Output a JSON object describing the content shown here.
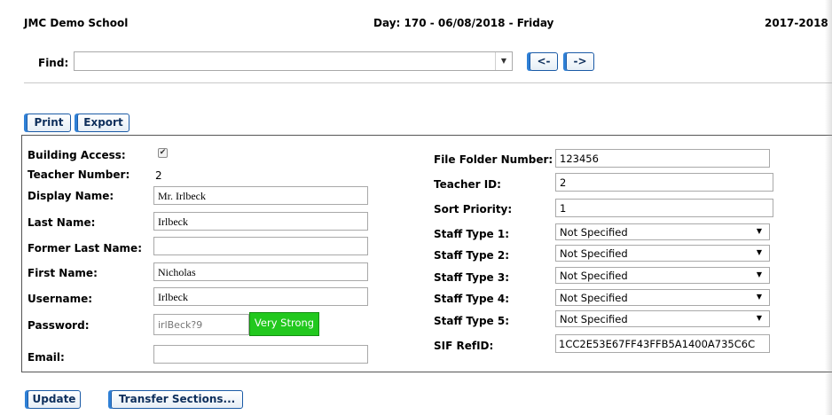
{
  "header": {
    "school": "JMC Demo School",
    "day": "Day: 170 - 06/08/2018 - Friday",
    "year": "2017-2018"
  },
  "find": {
    "label": "Find:",
    "value": "",
    "prev_label": "<-",
    "next_label": "->"
  },
  "toolbar": {
    "print_label": "Print",
    "export_label": "Export"
  },
  "left_fields": {
    "building_access_label": "Building Access:",
    "building_access_checked": true,
    "teacher_number_label": "Teacher Number:",
    "teacher_number_value": "2",
    "display_name_label": "Display Name:",
    "display_name_value": "Mr. Irlbeck",
    "last_name_label": "Last Name:",
    "last_name_value": "Irlbeck",
    "former_last_name_label": "Former Last Name:",
    "former_last_name_value": "",
    "first_name_label": "First Name:",
    "first_name_value": "Nicholas",
    "username_label": "Username:",
    "username_value": "Irlbeck",
    "password_label": "Password:",
    "password_value": "irlBeck?9",
    "password_strength": "Very Strong",
    "email_label": "Email:",
    "email_value": ""
  },
  "right_fields": {
    "file_folder_label": "File Folder Number:",
    "file_folder_value": "123456",
    "teacher_id_label": "Teacher ID:",
    "teacher_id_value": "2",
    "sort_priority_label": "Sort Priority:",
    "sort_priority_value": "1",
    "staff_types": [
      {
        "label": "Staff Type 1:",
        "value": "Not Specified"
      },
      {
        "label": "Staff Type 2:",
        "value": "Not Specified"
      },
      {
        "label": "Staff Type 3:",
        "value": "Not Specified"
      },
      {
        "label": "Staff Type 4:",
        "value": "Not Specified"
      },
      {
        "label": "Staff Type 5:",
        "value": "Not Specified"
      }
    ],
    "sif_refid_label": "SIF RefID:",
    "sif_refid_value": "1CC2E53E67FF43FFB5A1400A735C6C"
  },
  "footer": {
    "update_label": "Update",
    "transfer_label": "Transfer Sections..."
  },
  "colors": {
    "button_border": "#1a5aa6",
    "strength_green": "#22c81e"
  }
}
